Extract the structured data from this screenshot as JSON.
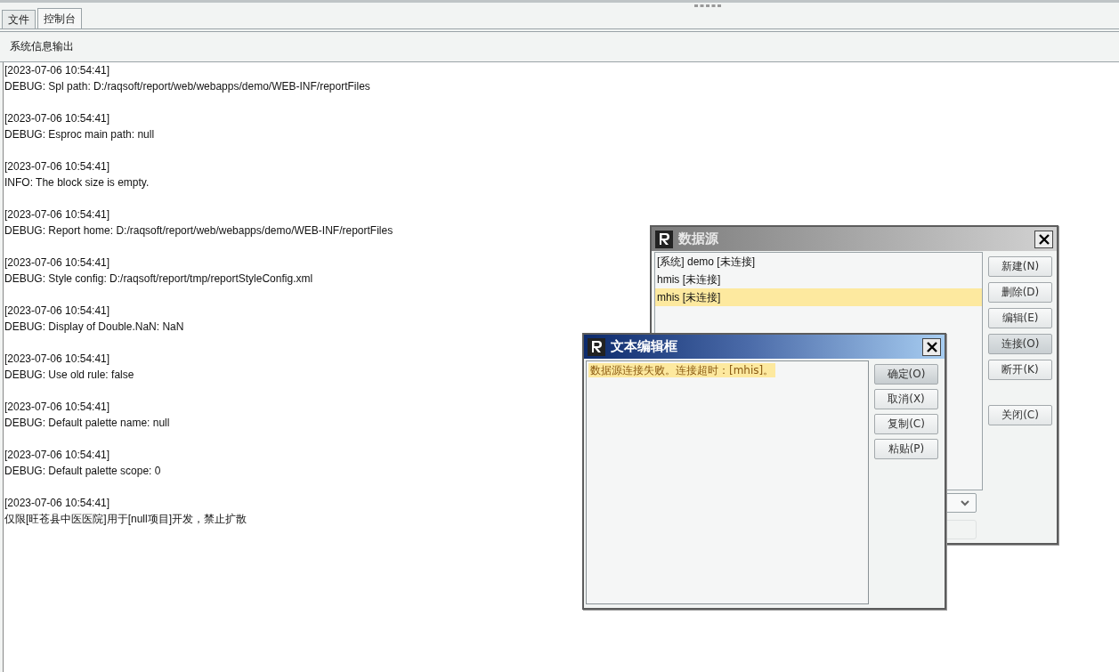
{
  "tabs": [
    {
      "label": "文件",
      "selected": false
    },
    {
      "label": "控制台",
      "selected": true
    }
  ],
  "panel": {
    "title": "系统信息输出"
  },
  "log": [
    {
      "time": "[2023-07-06 10:54:41]",
      "message": "DEBUG: Spl path: D:/raqsoft/report/web/webapps/demo/WEB-INF/reportFiles"
    },
    {
      "time": "[2023-07-06 10:54:41]",
      "message": "DEBUG: Esproc main path: null"
    },
    {
      "time": "[2023-07-06 10:54:41]",
      "message": "INFO: The block size is empty."
    },
    {
      "time": "[2023-07-06 10:54:41]",
      "message": "DEBUG: Report home: D:/raqsoft/report/web/webapps/demo/WEB-INF/reportFiles"
    },
    {
      "time": "[2023-07-06 10:54:41]",
      "message": "DEBUG: Style config: D:/raqsoft/report/tmp/reportStyleConfig.xml"
    },
    {
      "time": "[2023-07-06 10:54:41]",
      "message": "DEBUG: Display of Double.NaN: NaN"
    },
    {
      "time": "[2023-07-06 10:54:41]",
      "message": "DEBUG: Use old rule: false"
    },
    {
      "time": "[2023-07-06 10:54:41]",
      "message": "DEBUG: Default palette name: null"
    },
    {
      "time": "[2023-07-06 10:54:41]",
      "message": "DEBUG: Default palette scope: 0"
    },
    {
      "time": "[2023-07-06 10:54:41]",
      "message": "仅限[旺苍县中医医院]用于[null项目]开发，禁止扩散"
    }
  ],
  "datasource_dialog": {
    "title": "数据源",
    "items": [
      {
        "label": "[系统] demo [未连接]",
        "selected": false
      },
      {
        "label": "hmis [未连接]",
        "selected": false
      },
      {
        "label": "mhis [未连接]",
        "selected": true
      }
    ],
    "buttons": [
      {
        "label": "新建(N)",
        "pressed": false
      },
      {
        "label": "删除(D)",
        "pressed": false
      },
      {
        "label": "编辑(E)",
        "pressed": false
      },
      {
        "label": "连接(O)",
        "pressed": true
      },
      {
        "label": "断开(K)",
        "pressed": false
      }
    ],
    "close_button": "关闭(C)"
  },
  "text_dialog": {
    "title": "文本编辑框",
    "message": "数据源连接失败。连接超时：[mhis]。",
    "buttons": [
      {
        "label": "确定(O)",
        "default": true
      },
      {
        "label": "取消(X)",
        "default": false
      },
      {
        "label": "复制(C)",
        "default": false
      },
      {
        "label": "粘贴(P)",
        "default": false
      }
    ]
  }
}
